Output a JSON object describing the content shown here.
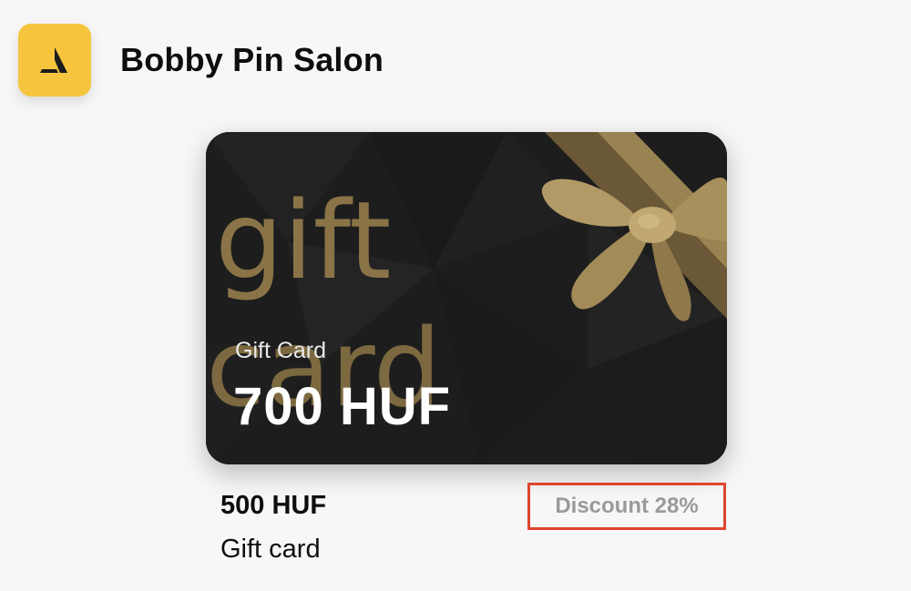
{
  "header": {
    "logo_icon": "salon-logo-icon",
    "salon_name": "Bobby Pin Salon"
  },
  "gift_card": {
    "background_text_top": "gift",
    "background_text_bottom": "card",
    "label": "Gift Card",
    "amount": "700 HUF"
  },
  "product": {
    "price": "500 HUF",
    "name": "Gift card",
    "discount": "Discount 28%"
  },
  "colors": {
    "logo_bg": "#f6c53d",
    "card_bg": "#1e1e1e",
    "gold": "#8a7447",
    "highlight_border": "#e0452f"
  }
}
